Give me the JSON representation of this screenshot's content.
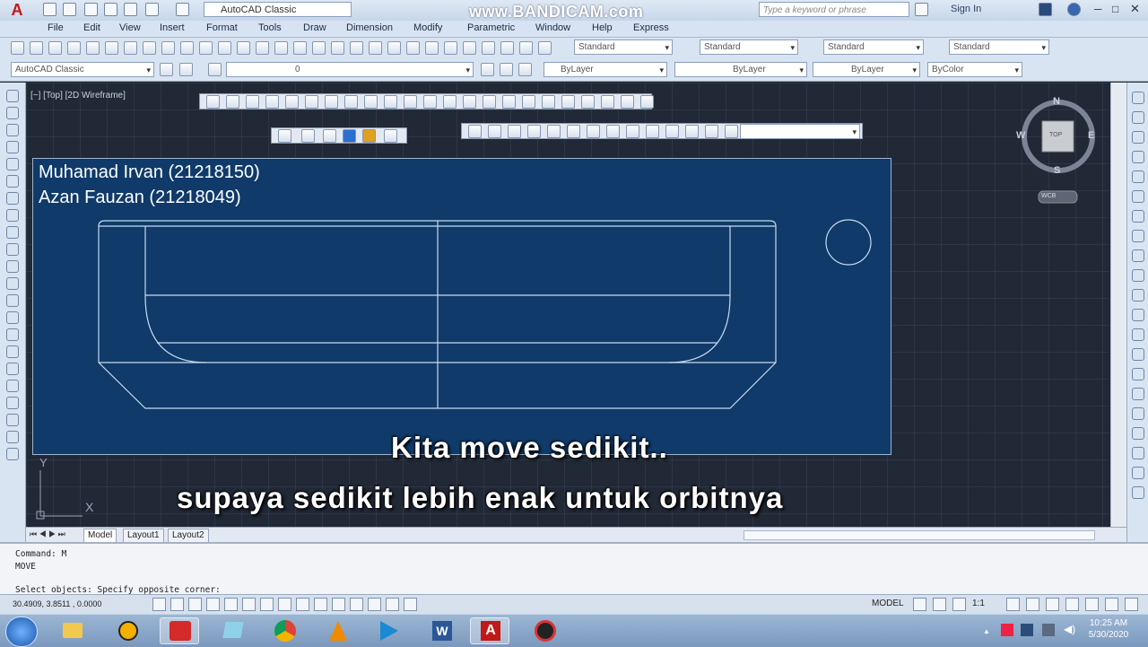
{
  "window": {
    "title_watermark": "www.BANDICAM.com",
    "workspace": "AutoCAD Classic",
    "search_placeholder": "Type a keyword or phrase",
    "sign_in": "Sign In"
  },
  "menu": [
    "File",
    "Edit",
    "View",
    "Insert",
    "Format",
    "Tools",
    "Draw",
    "Dimension",
    "Modify",
    "Parametric",
    "Window",
    "Help",
    "Express"
  ],
  "toolbar1": {
    "text_style": "Standard",
    "dim_style": "Standard",
    "table_style": "Standard",
    "mleader_style": "Standard"
  },
  "toolbar2": {
    "workspace": "AutoCAD Classic",
    "layer": "0",
    "color": "ByLayer",
    "linetype": "ByLayer",
    "lineweight": "ByLayer",
    "plotstyle": "ByColor"
  },
  "viewport": {
    "label": "[−] [Top] [2D Wireframe]",
    "viewcube_face": "TOP",
    "compass": {
      "n": "N",
      "s": "S",
      "e": "E",
      "w": "W"
    },
    "wcs": "WCB",
    "ucs_y": "Y",
    "ucs_x": "X"
  },
  "overlay": {
    "name1": "Muhamad Irvan (21218150)",
    "name2": "Azan Fauzan (21218049)",
    "subtitle1": "Kita move sedikit..",
    "subtitle2": "supaya sedikit lebih enak untuk orbitnya"
  },
  "tabs": [
    "Model",
    "Layout1",
    "Layout2"
  ],
  "command": {
    "line1": "Command: M",
    "line2": "MOVE",
    "line3": "Select objects: Specify opposite corner:"
  },
  "status": {
    "coords": "30.4909, 3.8511 , 0.0000",
    "model": "MODEL",
    "scale": "1:1"
  },
  "clock": {
    "time": "10:25 AM",
    "date": "5/30/2020"
  },
  "colors": {
    "drawing_bg": "#212836",
    "overlay_rect": "#0f3a6a",
    "geometry_line": "#c9d9ec"
  }
}
